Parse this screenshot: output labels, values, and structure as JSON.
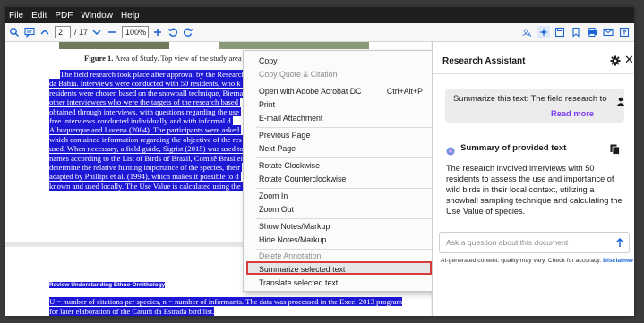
{
  "menubar": {
    "items": [
      "File",
      "Edit",
      "PDF",
      "Window",
      "Help"
    ]
  },
  "toolbar": {
    "page_current": "2",
    "page_total": "/ 17",
    "zoom": "100%"
  },
  "document": {
    "caption_bold": "Figure 1.",
    "caption": " Area of Study. Top view of the study area showing the mu",
    "body_lines": [
      "The field research took place after approval by the Research",
      "da Bahia. Interviews were conducted with 50 residents, who k",
      "residents were chosen based on the snowball technique, Bierna",
      "other interviewees who were the targets of the research based",
      "obtained through interviews, with questions regarding the use",
      "free interviews conducted individually and with informal d",
      "Albuquerque and Lucena (2004). The participants were asked",
      "which contained information regarding the objective of the res",
      "used. When necessary, a field guide, Sigrist (2015) was used to",
      "names according to the List of Birds of Brazil, Comitê Brasileir",
      "determine the relative hunting importance of the species, their",
      "adapted by Phillips et al. (1994), which makes it possible to d",
      "known and used locally. The Use Value is calculated using the"
    ],
    "page2_heading": "Review Understanding Ethno-Ornithology",
    "page2_lines": [
      "U = number of citations per species, n = number of informants. The data was processed in the Excel 2013 program",
      "for later elaboration of the Catuni da Estrada bird list."
    ]
  },
  "context_menu": {
    "copy": "Copy",
    "copy_quote": "Copy Quote & Citation",
    "open_acrobat": "Open with Adobe Acrobat DC",
    "open_acrobat_shortcut": "Ctrl+Alt+P",
    "print": "Print",
    "email": "E-mail Attachment",
    "prev_page": "Previous Page",
    "next_page": "Next Page",
    "rotate_cw": "Rotate Clockwise",
    "rotate_ccw": "Rotate Counterclockwise",
    "zoom_in": "Zoom In",
    "zoom_out": "Zoom Out",
    "show_notes": "Show Notes/Markup",
    "hide_notes": "Hide Notes/Markup",
    "delete_annotation": "Delete Annotation",
    "summarize": "Summarize selected text",
    "translate": "Translate selected text"
  },
  "assistant": {
    "title": "Research Assistant",
    "user_message": "Summarize this text: The field research took place after approval",
    "read_more": "Read more",
    "response_title": "Summary of provided text",
    "response_body": "The research involved interviews with 50 residents to assess the use and importance of wild birds in their local context, utilizing a snowball sampling technique and calculating the Use Value of species.",
    "ask_placeholder": "Ask a question about this document",
    "disclaimer": "AI-generated content: quality may vary. Check for accuracy.",
    "disclaimer_link": "Disclaimer"
  },
  "colors": {
    "selection": "#1d17d6",
    "menubar": "#1f1f1f",
    "accent_purple": "#7a3df0",
    "link_blue": "#1b66d4",
    "highlight_border": "#d93b3b"
  },
  "icons": [
    "search-icon",
    "comment-icon",
    "chevron-up-icon",
    "chevron-down-icon",
    "zoom-out-icon",
    "zoom-in-icon",
    "rotate-ccw-icon",
    "rotate-cw-icon",
    "translate-icon",
    "ai-assistant-icon",
    "save-icon",
    "bookmark-icon",
    "print-icon",
    "mail-icon",
    "export-icon",
    "gear-icon",
    "close-icon",
    "user-icon",
    "sparkle-icon",
    "copy-icon",
    "send-icon"
  ]
}
